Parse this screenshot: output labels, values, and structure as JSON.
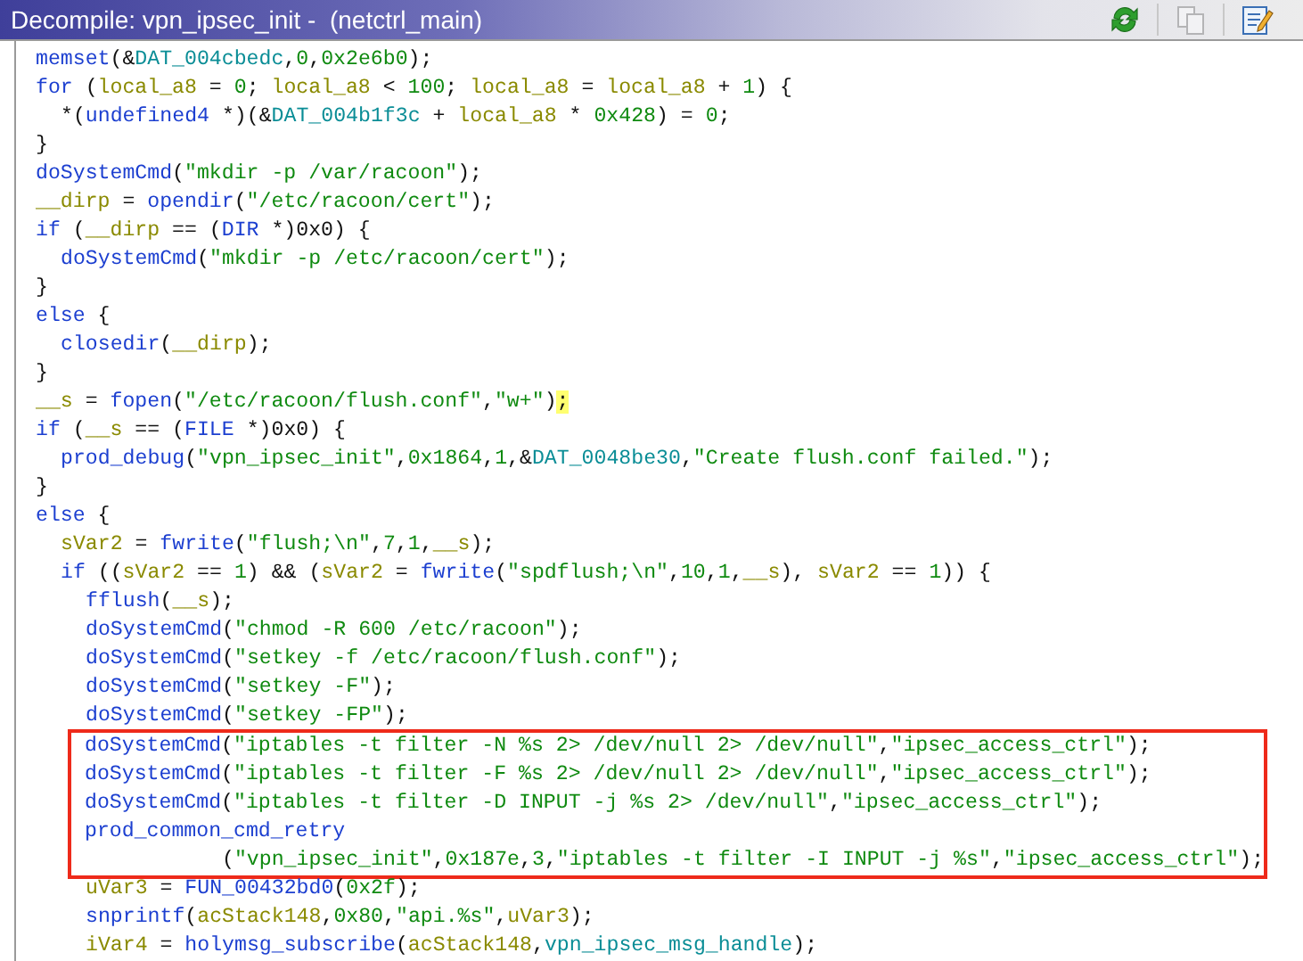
{
  "window": {
    "title": "Decompile: vpn_ipsec_init -  (netctrl_main)"
  },
  "toolbar": [
    {
      "kind": "refresh",
      "disabled": false
    },
    {
      "kind": "copy",
      "disabled": true
    },
    {
      "kind": "edit",
      "disabled": false
    }
  ],
  "code": {
    "lines": [
      {
        "boxed": false,
        "tokens": [
          {
            "kind": "fn",
            "text": "memset"
          },
          {
            "kind": "p",
            "text": "(&"
          },
          {
            "kind": "glob",
            "text": "DAT_004cbedc"
          },
          {
            "kind": "p",
            "text": ","
          },
          {
            "kind": "num",
            "text": "0"
          },
          {
            "kind": "p",
            "text": ","
          },
          {
            "kind": "num",
            "text": "0x2e6b0"
          },
          {
            "kind": "p",
            "text": ");"
          }
        ]
      },
      {
        "boxed": false,
        "tokens": [
          {
            "kind": "kw",
            "text": "for"
          },
          {
            "kind": "p",
            "text": " ("
          },
          {
            "kind": "var",
            "text": "local_a8"
          },
          {
            "kind": "p",
            "text": " = "
          },
          {
            "kind": "num",
            "text": "0"
          },
          {
            "kind": "p",
            "text": "; "
          },
          {
            "kind": "var",
            "text": "local_a8"
          },
          {
            "kind": "p",
            "text": " < "
          },
          {
            "kind": "num",
            "text": "100"
          },
          {
            "kind": "p",
            "text": "; "
          },
          {
            "kind": "var",
            "text": "local_a8"
          },
          {
            "kind": "p",
            "text": " = "
          },
          {
            "kind": "var",
            "text": "local_a8"
          },
          {
            "kind": "p",
            "text": " + "
          },
          {
            "kind": "num",
            "text": "1"
          },
          {
            "kind": "p",
            "text": ") {"
          }
        ],
        "children": [
          {
            "boxed": false,
            "tokens": [
              {
                "kind": "p",
                "text": "*("
              },
              {
                "kind": "type",
                "text": "undefined4"
              },
              {
                "kind": "p",
                "text": " *)(&"
              },
              {
                "kind": "glob",
                "text": "DAT_004b1f3c"
              },
              {
                "kind": "p",
                "text": " + "
              },
              {
                "kind": "var",
                "text": "local_a8"
              },
              {
                "kind": "p",
                "text": " * "
              },
              {
                "kind": "num",
                "text": "0x428"
              },
              {
                "kind": "p",
                "text": ") = "
              },
              {
                "kind": "num",
                "text": "0"
              },
              {
                "kind": "p",
                "text": ";"
              }
            ]
          }
        ]
      },
      {
        "boxed": false,
        "tokens": [
          {
            "kind": "p",
            "text": "}"
          }
        ]
      },
      {
        "boxed": false,
        "tokens": [
          {
            "kind": "fn",
            "text": "doSystemCmd"
          },
          {
            "kind": "p",
            "text": "("
          },
          {
            "kind": "str",
            "text": "\"mkdir -p /var/racoon\""
          },
          {
            "kind": "p",
            "text": ");"
          }
        ]
      },
      {
        "boxed": false,
        "tokens": [
          {
            "kind": "var",
            "text": "__dirp"
          },
          {
            "kind": "p",
            "text": " = "
          },
          {
            "kind": "fn",
            "text": "opendir"
          },
          {
            "kind": "p",
            "text": "("
          },
          {
            "kind": "str",
            "text": "\"/etc/racoon/cert\""
          },
          {
            "kind": "p",
            "text": ");"
          }
        ]
      },
      {
        "boxed": false,
        "tokens": [
          {
            "kind": "kw",
            "text": "if"
          },
          {
            "kind": "p",
            "text": " ("
          },
          {
            "kind": "var",
            "text": "__dirp"
          },
          {
            "kind": "p",
            "text": " == ("
          },
          {
            "kind": "type",
            "text": "DIR"
          },
          {
            "kind": "p",
            "text": " *)0x0) {"
          }
        ],
        "children": [
          {
            "boxed": false,
            "tokens": [
              {
                "kind": "fn",
                "text": "doSystemCmd"
              },
              {
                "kind": "p",
                "text": "("
              },
              {
                "kind": "str",
                "text": "\"mkdir -p /etc/racoon/cert\""
              },
              {
                "kind": "p",
                "text": ");"
              }
            ]
          }
        ]
      },
      {
        "boxed": false,
        "tokens": [
          {
            "kind": "p",
            "text": "}"
          }
        ]
      },
      {
        "boxed": false,
        "tokens": [
          {
            "kind": "kw",
            "text": "else"
          },
          {
            "kind": "p",
            "text": " {"
          }
        ],
        "children": [
          {
            "boxed": false,
            "tokens": [
              {
                "kind": "fn",
                "text": "closedir"
              },
              {
                "kind": "p",
                "text": "("
              },
              {
                "kind": "var",
                "text": "__dirp"
              },
              {
                "kind": "p",
                "text": ");"
              }
            ]
          }
        ]
      },
      {
        "boxed": false,
        "tokens": [
          {
            "kind": "p",
            "text": "}"
          }
        ]
      },
      {
        "boxed": false,
        "tokens": [
          {
            "kind": "var",
            "text": "__s"
          },
          {
            "kind": "p",
            "text": " = "
          },
          {
            "kind": "fn",
            "text": "fopen"
          },
          {
            "kind": "p",
            "text": "("
          },
          {
            "kind": "str",
            "text": "\"/etc/racoon/flush.conf\""
          },
          {
            "kind": "p",
            "text": ","
          },
          {
            "kind": "str",
            "text": "\"w+\""
          },
          {
            "kind": "p",
            "text": ")"
          },
          {
            "kind": "match",
            "text": ";"
          }
        ]
      },
      {
        "boxed": false,
        "tokens": [
          {
            "kind": "kw",
            "text": "if"
          },
          {
            "kind": "p",
            "text": " ("
          },
          {
            "kind": "var",
            "text": "__s"
          },
          {
            "kind": "p",
            "text": " == ("
          },
          {
            "kind": "type",
            "text": "FILE"
          },
          {
            "kind": "p",
            "text": " *)0x0) {"
          }
        ],
        "children": [
          {
            "boxed": false,
            "tokens": [
              {
                "kind": "fn",
                "text": "prod_debug"
              },
              {
                "kind": "p",
                "text": "("
              },
              {
                "kind": "str",
                "text": "\"vpn_ipsec_init\""
              },
              {
                "kind": "p",
                "text": ","
              },
              {
                "kind": "num",
                "text": "0x1864"
              },
              {
                "kind": "p",
                "text": ","
              },
              {
                "kind": "num",
                "text": "1"
              },
              {
                "kind": "p",
                "text": ",&"
              },
              {
                "kind": "glob",
                "text": "DAT_0048be30"
              },
              {
                "kind": "p",
                "text": ","
              },
              {
                "kind": "str",
                "text": "\"Create flush.conf failed.\""
              },
              {
                "kind": "p",
                "text": ");"
              }
            ]
          }
        ]
      },
      {
        "boxed": false,
        "tokens": [
          {
            "kind": "p",
            "text": "}"
          }
        ]
      },
      {
        "boxed": false,
        "tokens": [
          {
            "kind": "kw",
            "text": "else"
          },
          {
            "kind": "p",
            "text": " {"
          }
        ],
        "children": [
          {
            "boxed": false,
            "tokens": [
              {
                "kind": "var",
                "text": "sVar2"
              },
              {
                "kind": "p",
                "text": " = "
              },
              {
                "kind": "fn",
                "text": "fwrite"
              },
              {
                "kind": "p",
                "text": "("
              },
              {
                "kind": "str",
                "text": "\"flush;\\n\""
              },
              {
                "kind": "p",
                "text": ","
              },
              {
                "kind": "num",
                "text": "7"
              },
              {
                "kind": "p",
                "text": ","
              },
              {
                "kind": "num",
                "text": "1"
              },
              {
                "kind": "p",
                "text": ","
              },
              {
                "kind": "var",
                "text": "__s"
              },
              {
                "kind": "p",
                "text": ");"
              }
            ]
          },
          {
            "boxed": false,
            "tokens": [
              {
                "kind": "kw",
                "text": "if"
              },
              {
                "kind": "p",
                "text": " (("
              },
              {
                "kind": "var",
                "text": "sVar2"
              },
              {
                "kind": "p",
                "text": " == "
              },
              {
                "kind": "num",
                "text": "1"
              },
              {
                "kind": "p",
                "text": ") && ("
              },
              {
                "kind": "var",
                "text": "sVar2"
              },
              {
                "kind": "p",
                "text": " = "
              },
              {
                "kind": "fn",
                "text": "fwrite"
              },
              {
                "kind": "p",
                "text": "("
              },
              {
                "kind": "str",
                "text": "\"spdflush;\\n\""
              },
              {
                "kind": "p",
                "text": ","
              },
              {
                "kind": "num",
                "text": "10"
              },
              {
                "kind": "p",
                "text": ","
              },
              {
                "kind": "num",
                "text": "1"
              },
              {
                "kind": "p",
                "text": ","
              },
              {
                "kind": "var",
                "text": "__s"
              },
              {
                "kind": "p",
                "text": "), "
              },
              {
                "kind": "var",
                "text": "sVar2"
              },
              {
                "kind": "p",
                "text": " == "
              },
              {
                "kind": "num",
                "text": "1"
              },
              {
                "kind": "p",
                "text": ")) {"
              }
            ],
            "children": [
              {
                "boxed": false,
                "tokens": [
                  {
                    "kind": "fn",
                    "text": "fflush"
                  },
                  {
                    "kind": "p",
                    "text": "("
                  },
                  {
                    "kind": "var",
                    "text": "__s"
                  },
                  {
                    "kind": "p",
                    "text": ");"
                  }
                ]
              },
              {
                "boxed": false,
                "tokens": [
                  {
                    "kind": "fn",
                    "text": "doSystemCmd"
                  },
                  {
                    "kind": "p",
                    "text": "("
                  },
                  {
                    "kind": "str",
                    "text": "\"chmod -R 600 /etc/racoon\""
                  },
                  {
                    "kind": "p",
                    "text": ");"
                  }
                ]
              },
              {
                "boxed": false,
                "tokens": [
                  {
                    "kind": "fn",
                    "text": "doSystemCmd"
                  },
                  {
                    "kind": "p",
                    "text": "("
                  },
                  {
                    "kind": "str",
                    "text": "\"setkey -f /etc/racoon/flush.conf\""
                  },
                  {
                    "kind": "p",
                    "text": ");"
                  }
                ]
              },
              {
                "boxed": false,
                "tokens": [
                  {
                    "kind": "fn",
                    "text": "doSystemCmd"
                  },
                  {
                    "kind": "p",
                    "text": "("
                  },
                  {
                    "kind": "str",
                    "text": "\"setkey -F\""
                  },
                  {
                    "kind": "p",
                    "text": ");"
                  }
                ]
              },
              {
                "boxed": false,
                "tokens": [
                  {
                    "kind": "fn",
                    "text": "doSystemCmd"
                  },
                  {
                    "kind": "p",
                    "text": "("
                  },
                  {
                    "kind": "str",
                    "text": "\"setkey -FP\""
                  },
                  {
                    "kind": "p",
                    "text": ");"
                  }
                ]
              },
              {
                "boxed": true,
                "tokens": [
                  {
                    "kind": "fn",
                    "text": "doSystemCmd"
                  },
                  {
                    "kind": "p",
                    "text": "("
                  },
                  {
                    "kind": "str",
                    "text": "\"iptables -t filter -N %s 2> /dev/null 2> /dev/null\""
                  },
                  {
                    "kind": "p",
                    "text": ","
                  },
                  {
                    "kind": "str",
                    "text": "\"ipsec_access_ctrl\""
                  },
                  {
                    "kind": "p",
                    "text": ");"
                  }
                ]
              },
              {
                "boxed": true,
                "tokens": [
                  {
                    "kind": "fn",
                    "text": "doSystemCmd"
                  },
                  {
                    "kind": "p",
                    "text": "("
                  },
                  {
                    "kind": "str",
                    "text": "\"iptables -t filter -F %s 2> /dev/null 2> /dev/null\""
                  },
                  {
                    "kind": "p",
                    "text": ","
                  },
                  {
                    "kind": "str",
                    "text": "\"ipsec_access_ctrl\""
                  },
                  {
                    "kind": "p",
                    "text": ");"
                  }
                ]
              },
              {
                "boxed": true,
                "tokens": [
                  {
                    "kind": "fn",
                    "text": "doSystemCmd"
                  },
                  {
                    "kind": "p",
                    "text": "("
                  },
                  {
                    "kind": "str",
                    "text": "\"iptables -t filter -D INPUT -j %s 2> /dev/null\""
                  },
                  {
                    "kind": "p",
                    "text": ","
                  },
                  {
                    "kind": "str",
                    "text": "\"ipsec_access_ctrl\""
                  },
                  {
                    "kind": "p",
                    "text": ");"
                  }
                ]
              },
              {
                "boxed": true,
                "tokens": [
                  {
                    "kind": "fn",
                    "text": "prod_common_cmd_retry"
                  }
                ],
                "wrapped": [
                  {
                    "tokens": [
                      {
                        "kind": "p",
                        "text": "("
                      },
                      {
                        "kind": "str",
                        "text": "\"vpn_ipsec_init\""
                      },
                      {
                        "kind": "p",
                        "text": ","
                      },
                      {
                        "kind": "num",
                        "text": "0x187e"
                      },
                      {
                        "kind": "p",
                        "text": ","
                      },
                      {
                        "kind": "num",
                        "text": "3"
                      },
                      {
                        "kind": "p",
                        "text": ","
                      },
                      {
                        "kind": "str",
                        "text": "\"iptables -t filter -I INPUT -j %s\""
                      },
                      {
                        "kind": "p",
                        "text": ","
                      },
                      {
                        "kind": "str",
                        "text": "\"ipsec_access_ctrl\""
                      },
                      {
                        "kind": "p",
                        "text": ");"
                      }
                    ]
                  }
                ]
              },
              {
                "boxed": false,
                "tokens": [
                  {
                    "kind": "var",
                    "text": "uVar3"
                  },
                  {
                    "kind": "p",
                    "text": " = "
                  },
                  {
                    "kind": "fn",
                    "text": "FUN_00432bd0"
                  },
                  {
                    "kind": "p",
                    "text": "("
                  },
                  {
                    "kind": "num",
                    "text": "0x2f"
                  },
                  {
                    "kind": "p",
                    "text": ");"
                  }
                ]
              },
              {
                "boxed": false,
                "tokens": [
                  {
                    "kind": "fn",
                    "text": "snprintf"
                  },
                  {
                    "kind": "p",
                    "text": "("
                  },
                  {
                    "kind": "var",
                    "text": "acStack148"
                  },
                  {
                    "kind": "p",
                    "text": ","
                  },
                  {
                    "kind": "num",
                    "text": "0x80"
                  },
                  {
                    "kind": "p",
                    "text": ","
                  },
                  {
                    "kind": "str",
                    "text": "\"api.%s\""
                  },
                  {
                    "kind": "p",
                    "text": ","
                  },
                  {
                    "kind": "var",
                    "text": "uVar3"
                  },
                  {
                    "kind": "p",
                    "text": ");"
                  }
                ]
              },
              {
                "boxed": false,
                "tokens": [
                  {
                    "kind": "var",
                    "text": "iVar4"
                  },
                  {
                    "kind": "p",
                    "text": " = "
                  },
                  {
                    "kind": "fn",
                    "text": "holymsg_subscribe"
                  },
                  {
                    "kind": "p",
                    "text": "("
                  },
                  {
                    "kind": "var",
                    "text": "acStack148"
                  },
                  {
                    "kind": "p",
                    "text": ","
                  },
                  {
                    "kind": "glob",
                    "text": "vpn_ipsec_msg_handle"
                  },
                  {
                    "kind": "p",
                    "text": ");"
                  }
                ]
              }
            ]
          }
        ]
      }
    ]
  }
}
